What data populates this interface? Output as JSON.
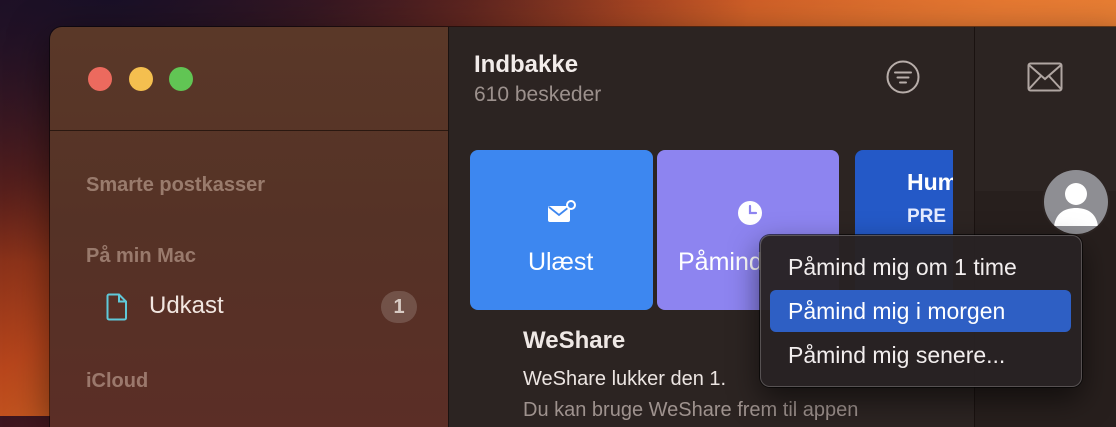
{
  "sidebar": {
    "sections": {
      "smart": "Smarte postkasser",
      "on_mac": "På min Mac",
      "icloud": "iCloud"
    },
    "items": [
      {
        "label": "Udkast",
        "badge": "1",
        "icon": "document-icon",
        "color": "#5fc9d9"
      }
    ]
  },
  "list": {
    "title": "Indbakke",
    "count_text": "610 beskeder",
    "filter_icon": "filter-icon"
  },
  "tiles": {
    "unread": {
      "label": "Ulæst",
      "icon": "envelope-badge-icon",
      "color": "#3d87f0"
    },
    "remind": {
      "label": "Påmind",
      "icon": "clock-icon",
      "color": "#8d84f0"
    },
    "hum": {
      "title": "Hum",
      "subtitle": "PRE",
      "color": "#2459c7"
    }
  },
  "message": {
    "sender": "WeShare",
    "subject": "WeShare lukker den 1.",
    "preview": "Du kan bruge WeShare frem til appen"
  },
  "detail": {
    "envelope_icon": "envelope-icon",
    "avatar_icon": "person-avatar-icon"
  },
  "popup_menu": {
    "items": [
      {
        "label": "Påmind mig om 1 time"
      },
      {
        "label": "Påmind mig i morgen",
        "selected": true
      },
      {
        "label": "Påmind mig senere..."
      }
    ],
    "highlight_color": "#2e5fc4"
  }
}
